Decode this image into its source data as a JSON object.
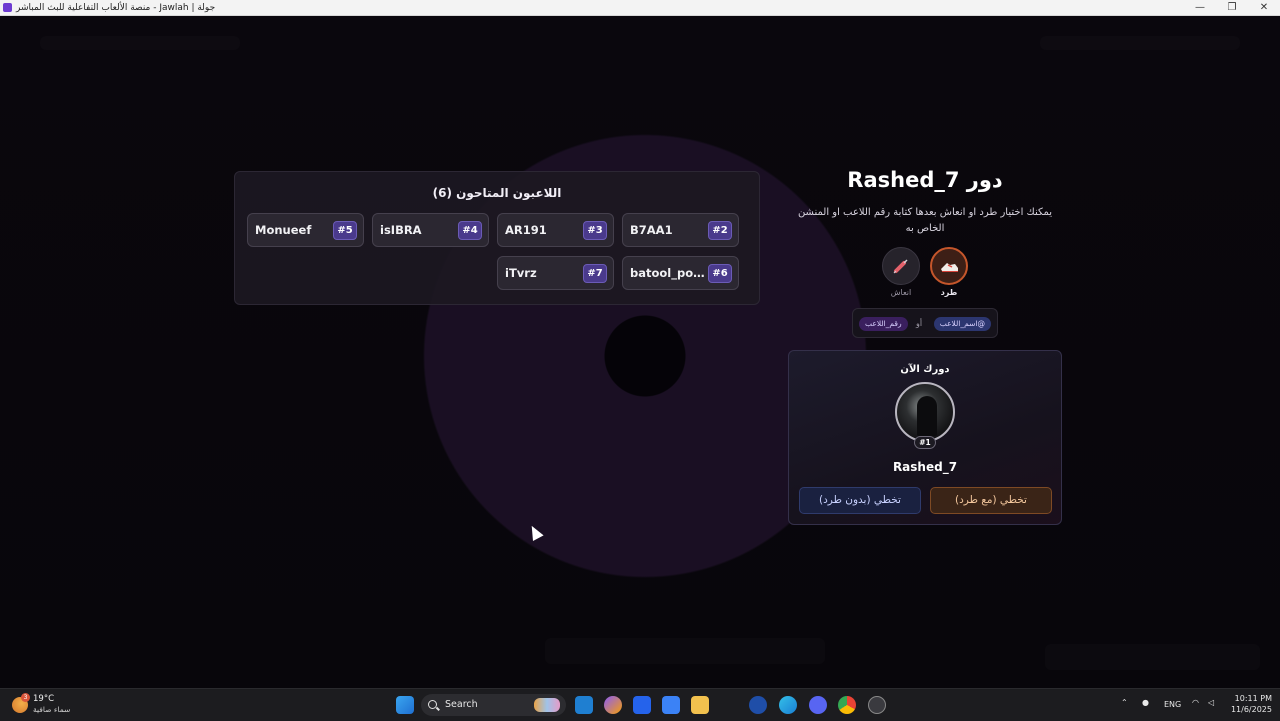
{
  "window": {
    "title": "منصة الألعاب التفاعلية للبث المباشر - Jawlah | جولة",
    "minimize": "—",
    "maximize": "❐",
    "close": "✕"
  },
  "players_panel": {
    "title": "اللاعبون المتاحون (6)",
    "players": [
      {
        "name": "B7AA1",
        "number": "#2"
      },
      {
        "name": "AR191",
        "number": "#3"
      },
      {
        "name": "isIBRA",
        "number": "#4"
      },
      {
        "name": "Monueef",
        "number": "#5"
      },
      {
        "name": "batool_pow...",
        "number": "#6"
      },
      {
        "name": "iTvrz",
        "number": "#7"
      }
    ]
  },
  "turn": {
    "title": "دور Rashed_7",
    "description": "يمكنك اختيار طرد او انعاش بعدها كتابة رقم اللاعب او المنشن الخاص به",
    "actions": {
      "kick_label": "طرد",
      "revive_label": "انعاش"
    },
    "tags": {
      "name_tag": "@اسم_اللاعب",
      "or": "أو",
      "number_tag": "رقم_اللاعب"
    }
  },
  "current": {
    "label": "دورك الآن",
    "player_name": "Rashed_7",
    "badge": "#1",
    "skip_with_kick": "تخطي (مع طرد)",
    "skip_without_kick": "تخطي (بدون طرد)"
  },
  "taskbar": {
    "weather_temp": "19°C",
    "weather_desc": "سماء صافية",
    "weather_badge": "3",
    "search_label": "Search",
    "language": "ENG",
    "time": "10:11 PM",
    "date": "11/6/2025"
  },
  "colors": {
    "accent_purple": "#4a3a8c",
    "kick_orange": "#c5562b",
    "background": "#070509"
  }
}
